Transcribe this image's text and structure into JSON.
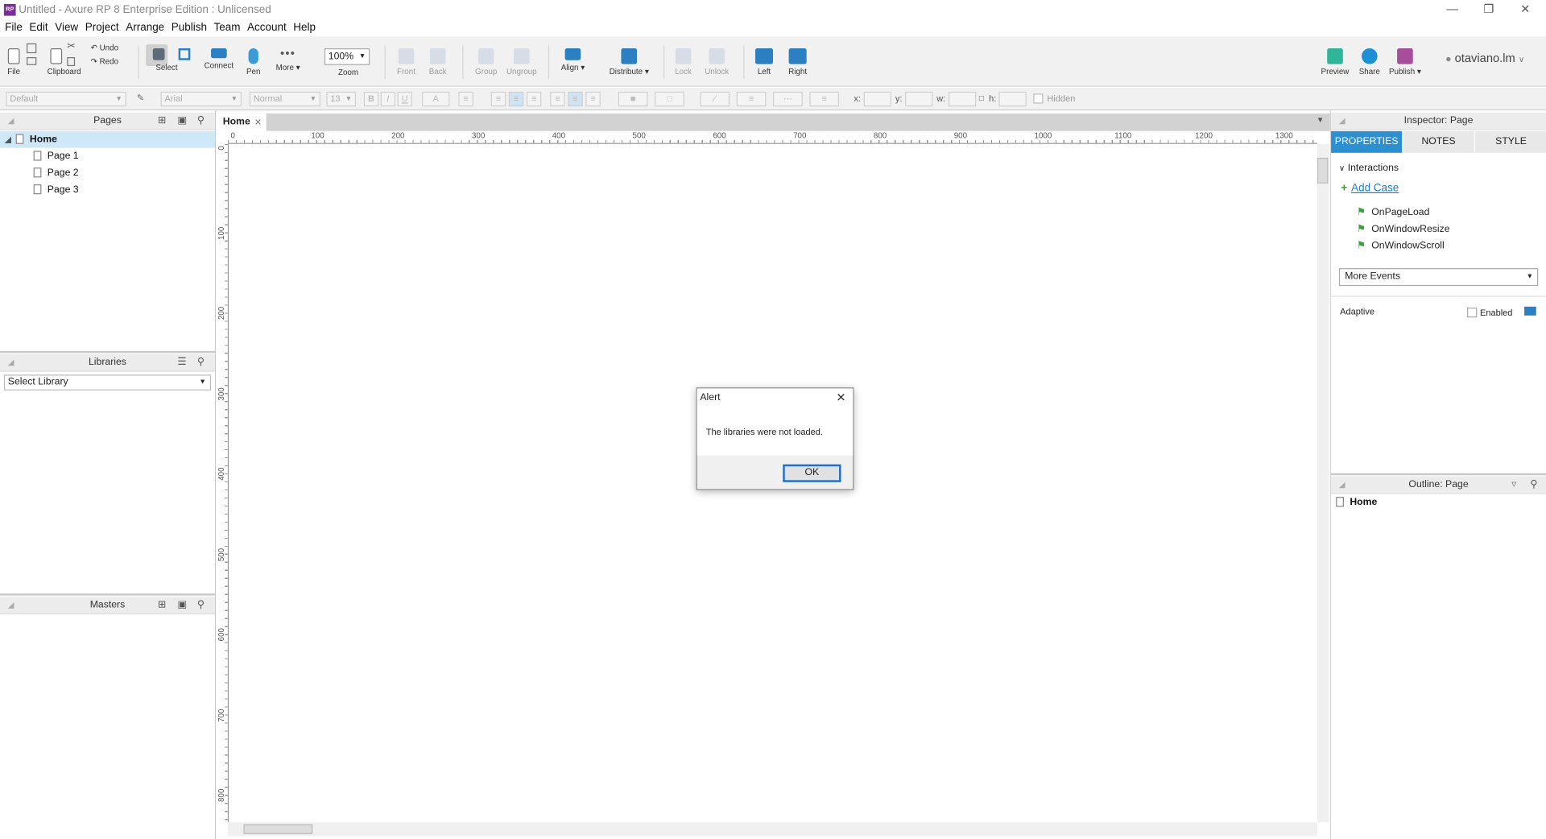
{
  "window": {
    "title": "Untitled - Axure RP 8 Enterprise Edition : Unlicensed",
    "logo_text": "RP"
  },
  "menu": [
    "File",
    "Edit",
    "View",
    "Project",
    "Arrange",
    "Publish",
    "Team",
    "Account",
    "Help"
  ],
  "toolbar": {
    "file": "File",
    "clipboard": "Clipboard",
    "undo": "Undo",
    "redo": "Redo",
    "select": "Select",
    "connect": "Connect",
    "pen": "Pen",
    "more": "More ▾",
    "zoom_value": "100%",
    "zoom": "Zoom",
    "front": "Front",
    "back": "Back",
    "group": "Group",
    "ungroup": "Ungroup",
    "align": "Align ▾",
    "distribute": "Distribute ▾",
    "lock": "Lock",
    "unlock": "Unlock",
    "left": "Left",
    "right": "Right",
    "preview": "Preview",
    "share": "Share",
    "publish": "Publish ▾",
    "user": "otaviano.lm"
  },
  "format": {
    "style": "Default",
    "font": "Arial",
    "weight": "Normal",
    "size": "13",
    "x_label": "x:",
    "y_label": "y:",
    "w_label": "w:",
    "h_label": "h:",
    "hidden": "Hidden"
  },
  "pages": {
    "title": "Pages",
    "root": "Home",
    "children": [
      "Page 1",
      "Page 2",
      "Page 3"
    ]
  },
  "libraries": {
    "title": "Libraries",
    "select": "Select Library"
  },
  "masters": {
    "title": "Masters"
  },
  "canvas": {
    "tab": "Home",
    "h_ruler": [
      "0",
      "100",
      "200",
      "300",
      "400",
      "500",
      "600",
      "700",
      "800",
      "900",
      "1000",
      "1100",
      "1200",
      "1300"
    ],
    "v_ruler": [
      "0",
      "100",
      "200",
      "300",
      "400",
      "500",
      "600",
      "700",
      "800"
    ]
  },
  "inspector": {
    "title": "Inspector: Page",
    "tabs": [
      "PROPERTIES",
      "NOTES",
      "STYLE"
    ],
    "interactions": "Interactions",
    "add_case": "Add Case",
    "events": [
      "OnPageLoad",
      "OnWindowResize",
      "OnWindowScroll"
    ],
    "more_events": "More Events",
    "adaptive": "Adaptive",
    "enabled": "Enabled"
  },
  "outline": {
    "title": "Outline: Page",
    "item": "Home"
  },
  "alert": {
    "title": "Alert",
    "message": "The libraries were not loaded.",
    "ok": "OK"
  },
  "colors": {
    "accent": "#1d8fd4",
    "tab_active": "#2c8fd0",
    "selected_row": "#cfe8f7",
    "add_case": "#1a7fc1"
  }
}
